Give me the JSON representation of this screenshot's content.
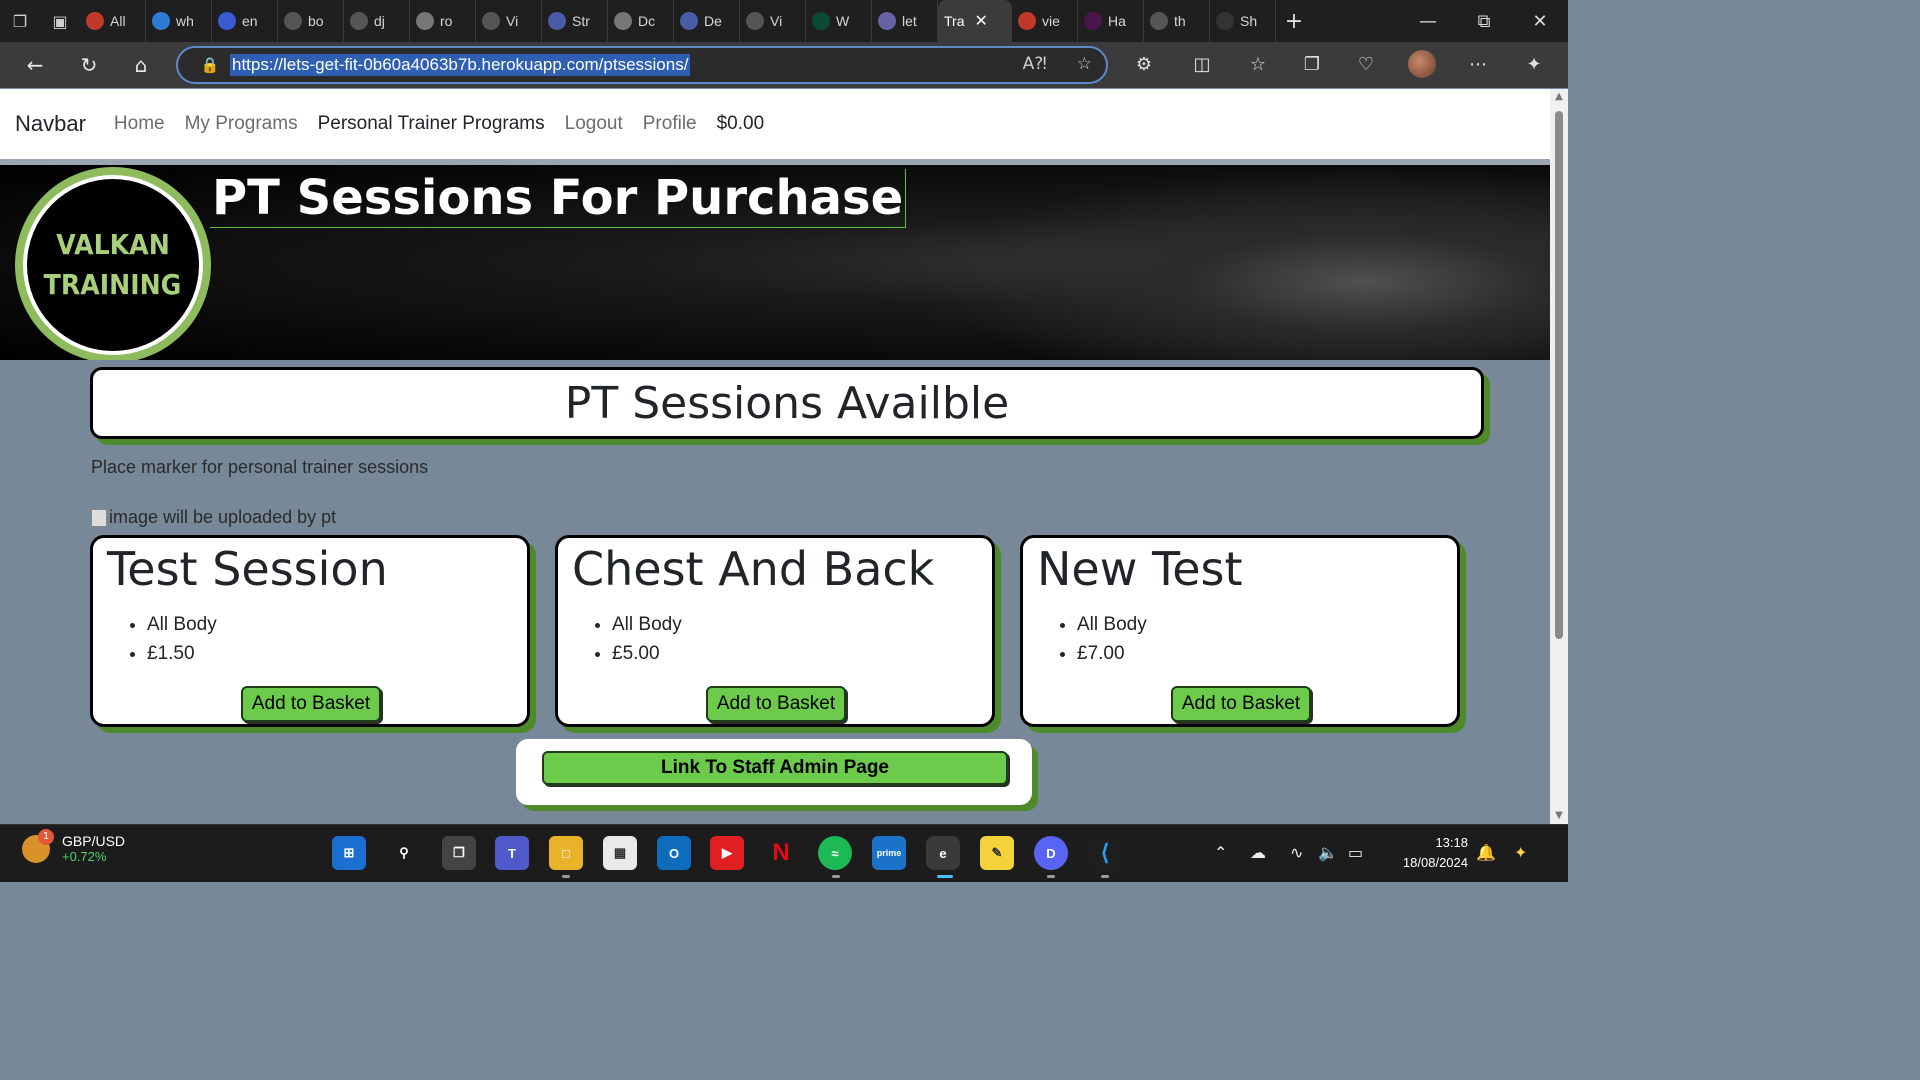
{
  "browser": {
    "tabs": [
      {
        "label": "All",
        "fav": "opera-icon",
        "color": "#c0392b"
      },
      {
        "label": "wh",
        "fav": "bing-icon",
        "color": "#2f7bd3"
      },
      {
        "label": "en",
        "fav": "search-icon",
        "color": "#3b5bd6"
      },
      {
        "label": "bo",
        "fav": "github-icon",
        "color": "#555555"
      },
      {
        "label": "dj",
        "fav": "github-icon",
        "color": "#555555"
      },
      {
        "label": "ro",
        "fav": "google-icon",
        "color": "#777777"
      },
      {
        "label": "Vi",
        "fav": "github-icon",
        "color": "#555555"
      },
      {
        "label": "Str",
        "fav": "s-icon",
        "color": "#4a5ca8"
      },
      {
        "label": "Dc",
        "fav": "google-icon",
        "color": "#777777"
      },
      {
        "label": "De",
        "fav": "s-icon",
        "color": "#4a5ca8"
      },
      {
        "label": "Vi",
        "fav": "github-icon",
        "color": "#555555"
      },
      {
        "label": "W",
        "fav": "dj-icon",
        "color": "#0c4b33"
      },
      {
        "label": "let",
        "fav": "heroku-icon",
        "color": "#6762a6"
      },
      {
        "label": "Tra",
        "fav": "",
        "color": "#3b3b3b",
        "active": true
      },
      {
        "label": "vie",
        "fav": "red-icon",
        "color": "#c0392b"
      },
      {
        "label": "Ha",
        "fav": "slack-icon",
        "color": "#4a154b"
      },
      {
        "label": "th",
        "fav": "github-icon",
        "color": "#555555"
      },
      {
        "label": "Sh",
        "fav": "nu-icon",
        "color": "#333333"
      }
    ],
    "url": "https://lets-get-fit-0b60a4063b7b.herokuapp.com/ptsessions/"
  },
  "navbar": {
    "brand": "Navbar",
    "links": [
      "Home",
      "My Programs",
      "Personal Trainer Programs",
      "Logout",
      "Profile",
      "$0.00"
    ]
  },
  "hero": {
    "title": "PT Sessions For Purchase",
    "logo_line1": "VALKAN",
    "logo_line2": "TRAINING"
  },
  "main": {
    "heading": "PT Sessions Availble",
    "description": "Place marker for personal trainer sessions",
    "image_alt": "image will be uploaded by pt",
    "sessions": [
      {
        "title": "Test Session",
        "type": "All Body",
        "price": "£1.50",
        "button": "Add to Basket"
      },
      {
        "title": "Chest And Back",
        "type": "All Body",
        "price": "£5.00",
        "button": "Add to Basket"
      },
      {
        "title": "New Test",
        "type": "All Body",
        "price": "£7.00",
        "button": "Add to Basket"
      }
    ],
    "staff_link": "Link To Staff Admin Page"
  },
  "taskbar": {
    "widget_title": "GBP/USD",
    "widget_change": "+0.72%",
    "widget_badge": "1",
    "time": "13:18",
    "date": "18/08/2024"
  },
  "colors": {
    "accent_green": "#6ccb4a",
    "shadow_green": "#4e8a2a",
    "page_bg": "#778899"
  }
}
